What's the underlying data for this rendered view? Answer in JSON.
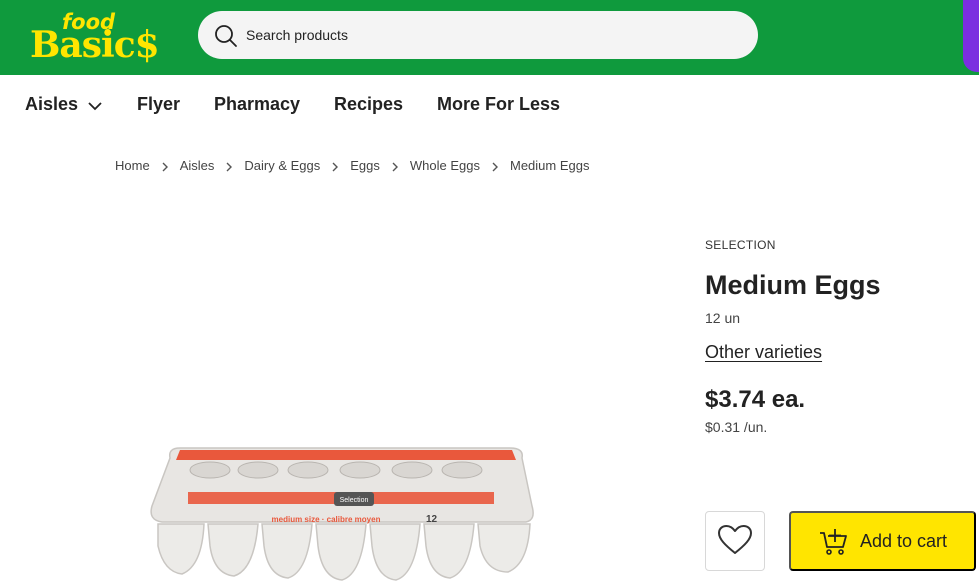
{
  "header": {
    "logo_top": "food",
    "logo_bottom": "Basic$",
    "search_placeholder": "Search products",
    "colors": {
      "brand_green": "#0f9a3d",
      "brand_yellow": "#ffe500",
      "promo_purple": "#7b2fe0"
    }
  },
  "nav": {
    "items": [
      {
        "label": "Aisles",
        "icon": "chevron-down-icon"
      },
      {
        "label": "Flyer"
      },
      {
        "label": "Pharmacy"
      },
      {
        "label": "Recipes"
      },
      {
        "label": "More For Less"
      }
    ]
  },
  "breadcrumb": [
    "Home",
    "Aisles",
    "Dairy & Eggs",
    "Eggs",
    "Whole Eggs",
    "Medium Eggs"
  ],
  "product": {
    "brand": "SELECTION",
    "name": "Medium Eggs",
    "size": "12 un",
    "varieties_link": "Other varieties",
    "price": "$3.74 ea.",
    "unit_price": "$0.31 /un.",
    "image_text": {
      "carton_label": "medium size · calibre moyen",
      "count": "12",
      "brand_mark": "Selection"
    },
    "favorite_icon": "heart-icon",
    "add_to_cart_label": "Add to cart",
    "cart_icon": "cart-plus-icon"
  }
}
